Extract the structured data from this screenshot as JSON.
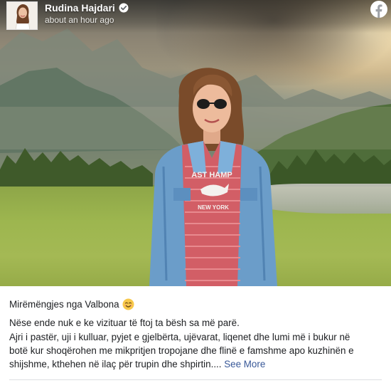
{
  "post": {
    "author_name": "Rudina Hajdari",
    "timestamp": "about an hour ago",
    "verified_icon": "verified-check-icon",
    "platform_icon": "facebook-icon",
    "photo_shirt_text_line1": "AST HAMP",
    "photo_shirt_text_line2": "NEW YORK",
    "caption": {
      "greeting": "Mirëmëngjes nga Valbona",
      "greeting_emoji": "smiling-face-icon",
      "line1": "Nëse ende nuk e ke vizituar të ftoj ta bësh sa më parë.",
      "line2": "Ajri i pastër, uji i kulluar, pyjet e gjelbërta, ujëvarat, liqenet dhe lumi më i bukur në",
      "line3": "botë kur shoqërohen me mikpritjen tropojane dhe flinë e famshme apo kuzhinën e",
      "line4": "shijshme, kthehen në ilaç për trupin dhe shpirtin....",
      "see_more": "See More"
    }
  },
  "colors": {
    "text": "#1c1e21",
    "link": "#385898",
    "divider": "#dddfe2"
  }
}
